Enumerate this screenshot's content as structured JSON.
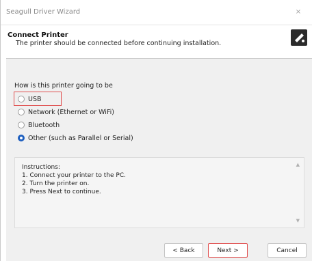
{
  "window": {
    "title": "Seagull Driver Wizard",
    "close_label": "×"
  },
  "header": {
    "title": "Connect Printer",
    "subtitle": "The printer should be connected before continuing installation."
  },
  "question": "How is this printer going to be",
  "options": [
    {
      "label": "USB",
      "checked": false
    },
    {
      "label": "Network (Ethernet or WiFi)",
      "checked": false
    },
    {
      "label": "Bluetooth",
      "checked": false
    },
    {
      "label": "Other (such as Parallel or Serial)",
      "checked": true
    }
  ],
  "instructions": {
    "heading": "Instructions:",
    "steps": [
      "1. Connect your printer to the PC.",
      "2. Turn the printer on.",
      "3. Press Next to continue."
    ],
    "scroll_up": "▲",
    "scroll_down": "▼"
  },
  "buttons": {
    "back": "< Back",
    "next": "Next >",
    "cancel": "Cancel"
  },
  "colors": {
    "accent": "#1e5fbf",
    "highlight": "#e04b4b"
  },
  "icons": {
    "header_logo": "printer-wizard-icon",
    "close": "close-icon"
  }
}
